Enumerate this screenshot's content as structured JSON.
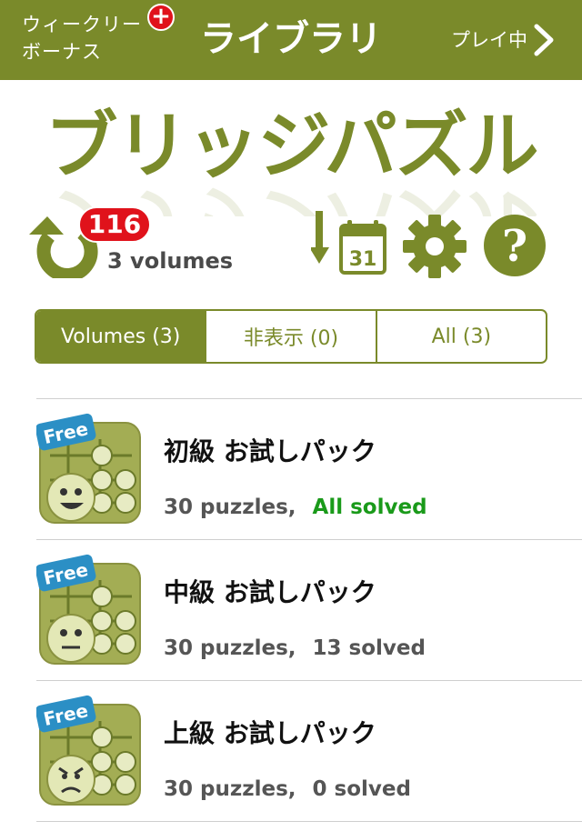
{
  "navbar": {
    "left_line1": "ウィークリー",
    "left_line2": "ボーナス",
    "left_badge": "+",
    "title": "ライブラリ",
    "right_label": "プレイ中"
  },
  "logo": {
    "text": "ブリッジパズル"
  },
  "toolbar": {
    "badge_count": "116",
    "volumes_label": "3 volumes",
    "calendar_day": "31",
    "help_glyph": "?"
  },
  "segments": [
    {
      "label": "Volumes (3)",
      "active": true
    },
    {
      "label": "非表示 (0)",
      "active": false
    },
    {
      "label": "All (3)",
      "active": false
    }
  ],
  "volumes": [
    {
      "title": "初級 お試しパック",
      "puzzles": "30 puzzles,",
      "status": "All solved",
      "badge": "Free"
    },
    {
      "title": "中級 お試しパック",
      "puzzles": "30 puzzles,",
      "status": "13 solved",
      "badge": "Free"
    },
    {
      "title": "上級 お試しパック",
      "puzzles": "30 puzzles,",
      "status": "0 solved",
      "badge": "Free"
    }
  ],
  "colors": {
    "brand": "#7a8a2a",
    "badge_red": "#e0121b",
    "solved_green": "#1a9a1a"
  },
  "icons": [
    "plus-icon",
    "chevron-right-icon",
    "refresh-icon",
    "download-calendar-icon",
    "gear-icon",
    "help-icon"
  ]
}
